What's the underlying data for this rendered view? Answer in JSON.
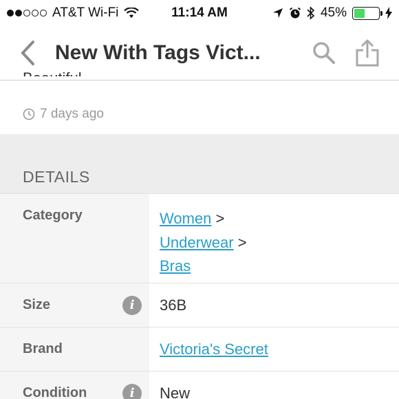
{
  "status_bar": {
    "carrier": "AT&T Wi-Fi",
    "time": "11:14 AM",
    "battery_percent": "45%",
    "battery_level": 0.45,
    "battery_color": "#4cd964"
  },
  "nav": {
    "title": "New With Tags Vict...",
    "back_icon": "chevron-left-icon",
    "search_icon": "search-icon",
    "share_icon": "share-icon"
  },
  "listing": {
    "description_tail": "Beautiful.",
    "posted": "7 days ago"
  },
  "details": {
    "header": "DETAILS",
    "category": {
      "label": "Category",
      "path": [
        "Women",
        "Underwear",
        "Bras"
      ],
      "separator": ">"
    },
    "size": {
      "label": "Size",
      "value": "36B"
    },
    "brand": {
      "label": "Brand",
      "value": "Victoria's Secret"
    },
    "condition": {
      "label": "Condition",
      "value": "New"
    }
  },
  "colors": {
    "link": "#2a9fc9",
    "muted": "#999999",
    "section_bg": "#ededed"
  }
}
